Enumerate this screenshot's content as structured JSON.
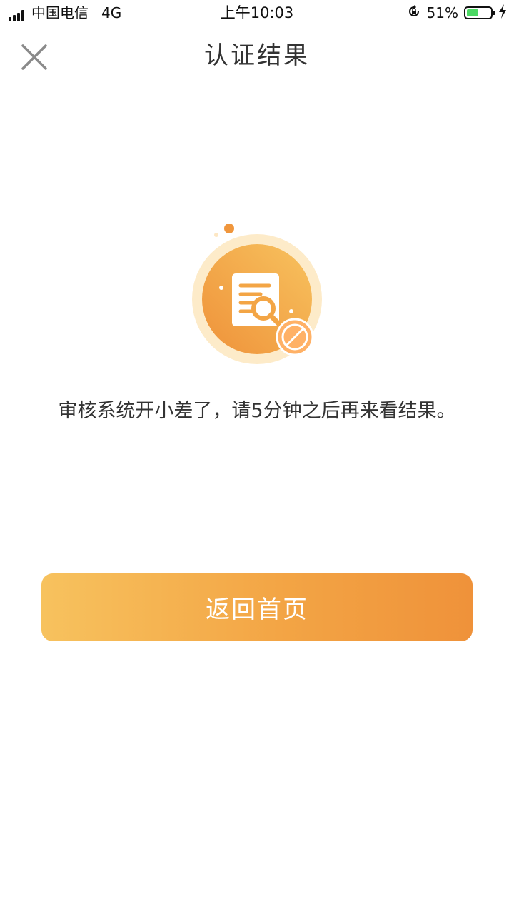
{
  "status_bar": {
    "carrier": "中国电信",
    "network": "4G",
    "time": "上午10:03",
    "battery_percent": "51%",
    "battery_level": 0.51,
    "battery_color": "#4cd964",
    "icons": [
      "signal-icon",
      "orientation-lock-icon",
      "battery-icon",
      "charging-icon"
    ]
  },
  "nav": {
    "title": "认证结果",
    "close_icon": "close-icon"
  },
  "result": {
    "illustration": "document-search-blocked-icon",
    "message": "审核系统开小差了，请5分钟之后再来看结果。"
  },
  "actions": {
    "home_label": "返回首页"
  },
  "colors": {
    "accent_start": "#f7c25e",
    "accent_end": "#ef923a"
  }
}
